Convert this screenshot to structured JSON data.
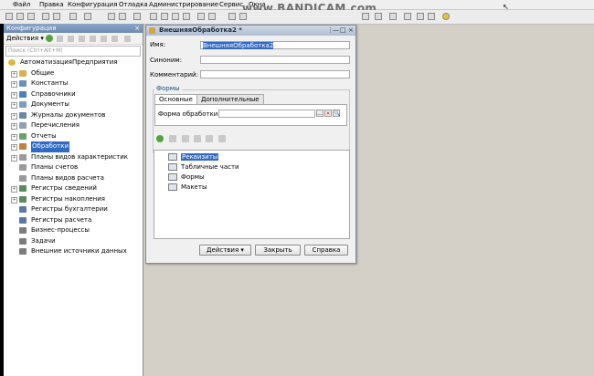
{
  "menu": {
    "items": [
      "Файл",
      "Правка",
      "Конфигурация",
      "Отладка",
      "Администрирование",
      "Сервис",
      "Окна"
    ]
  },
  "watermark": "www.BANDICAM.com",
  "config_panel": {
    "title": "Конфигурация",
    "close": "×",
    "actions_label": "Действия",
    "search_placeholder": "Поиск (Ctrl+Alt+M)",
    "root": "АвтоматизацияПредприятия",
    "items": [
      {
        "label": "Общие",
        "icon": "folder-icon",
        "color": "#d8b24a",
        "expand": "+"
      },
      {
        "label": "Константы",
        "icon": "constant-icon",
        "color": "#6a8fc0",
        "expand": "+"
      },
      {
        "label": "Справочники",
        "icon": "catalog-icon",
        "color": "#4b7fc2",
        "expand": "+"
      },
      {
        "label": "Документы",
        "icon": "document-icon",
        "color": "#7d9cc4",
        "expand": "+"
      },
      {
        "label": "Журналы документов",
        "icon": "journal-icon",
        "color": "#6b86a8",
        "expand": "+"
      },
      {
        "label": "Перечисления",
        "icon": "enum-icon",
        "color": "#8e9fb5",
        "expand": "+"
      },
      {
        "label": "Отчеты",
        "icon": "report-icon",
        "color": "#6aa26a",
        "expand": "+"
      },
      {
        "label": "Обработки",
        "icon": "processing-icon",
        "color": "#c0813c",
        "expand": "+",
        "selected": true
      },
      {
        "label": "Планы видов характеристик",
        "icon": "chart-types-icon",
        "color": "#9a9a9a",
        "expand": "+"
      },
      {
        "label": "Планы счетов",
        "icon": "chart-accounts-icon",
        "color": "#9a9a9a",
        "expand": ""
      },
      {
        "label": "Планы видов расчета",
        "icon": "calc-types-icon",
        "color": "#9a9a9a",
        "expand": ""
      },
      {
        "label": "Регистры сведений",
        "icon": "info-register-icon",
        "color": "#5b8a5b",
        "expand": "+"
      },
      {
        "label": "Регистры накопления",
        "icon": "accum-register-icon",
        "color": "#5b8a5b",
        "expand": "+"
      },
      {
        "label": "Регистры бухгалтерии",
        "icon": "acct-register-icon",
        "color": "#5a79a3",
        "expand": ""
      },
      {
        "label": "Регистры расчета",
        "icon": "calc-register-icon",
        "color": "#5a79a3",
        "expand": ""
      },
      {
        "label": "Бизнес-процессы",
        "icon": "business-process-icon",
        "color": "#7d7d7d",
        "expand": ""
      },
      {
        "label": "Задачи",
        "icon": "task-icon",
        "color": "#7d7d7d",
        "expand": ""
      },
      {
        "label": "Внешние источники данных",
        "icon": "external-data-icon",
        "color": "#7d7d7d",
        "expand": ""
      }
    ]
  },
  "dialog": {
    "title": "ВнешняяОбработка2 *",
    "controls": {
      "menu": "⋮",
      "minimize": "—",
      "maximize": "□",
      "close": "×"
    },
    "name_label": "Имя:",
    "name_value": "ВнешняяОбработка2",
    "synonym_label": "Синоним:",
    "synonym_value": "",
    "comment_label": "Комментарий:",
    "comment_value": "",
    "forms_group": "Формы",
    "tabs": [
      "Основные",
      "Дополнительные"
    ],
    "processing_form_label": "Форма обработки:",
    "processing_form_value": "",
    "form_buttons": {
      "more": "...",
      "clear": "×",
      "find": "🔍"
    },
    "list_items": [
      {
        "label": "Реквизиты",
        "selected": true
      },
      {
        "label": "Табличные части"
      },
      {
        "label": "Формы"
      },
      {
        "label": "Макеты"
      }
    ],
    "buttons": {
      "actions": "Действия",
      "close": "Закрыть",
      "help": "Справка"
    }
  }
}
